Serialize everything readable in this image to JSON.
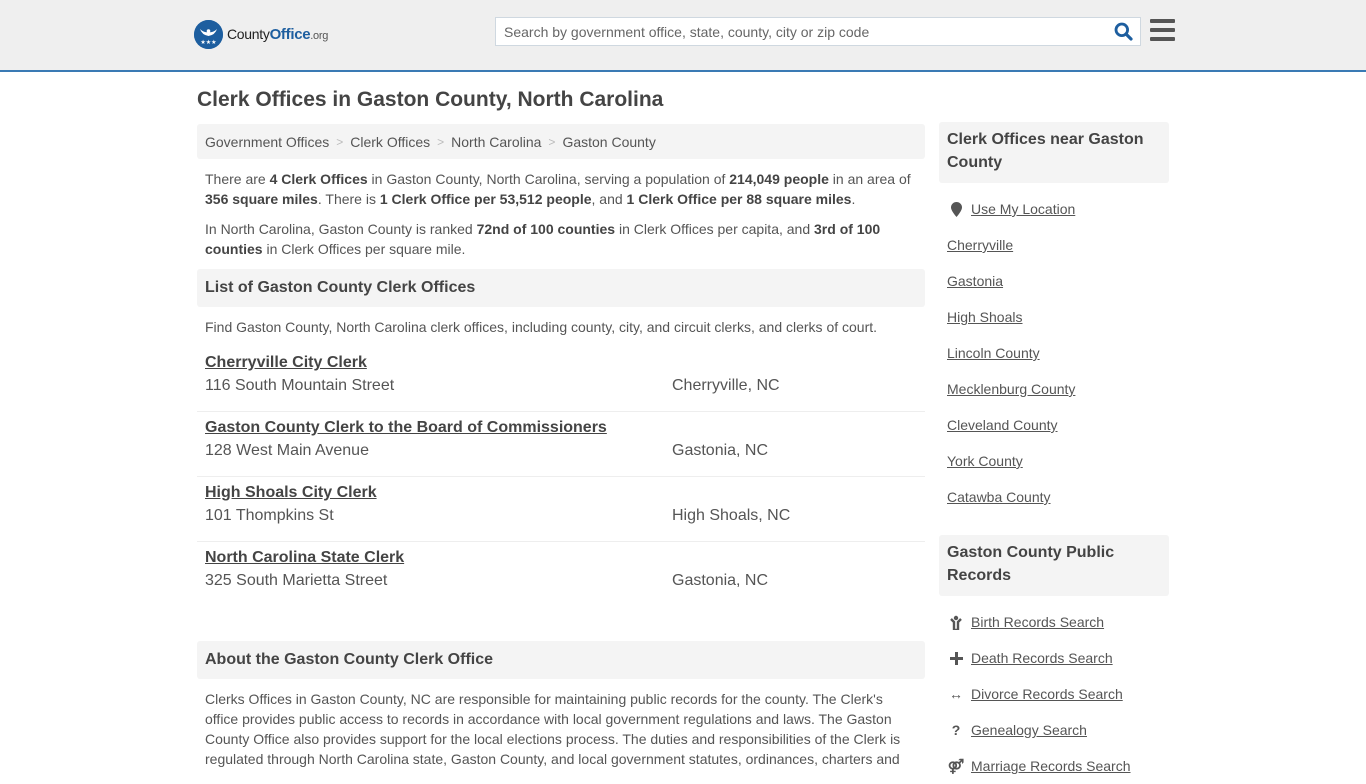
{
  "header": {
    "logo": {
      "brand_prefix": "County",
      "brand_main": "Office",
      "brand_suffix": ".org",
      "badge_stars": "★★★"
    },
    "search": {
      "placeholder": "Search by government office, state, county, city or zip code",
      "value": ""
    },
    "colors": {
      "accent": "#3a7ab4",
      "brand": "#1d5e9f"
    }
  },
  "page_title": "Clerk Offices in Gaston County, North Carolina",
  "breadcrumb": [
    "Government Offices",
    "Clerk Offices",
    "North Carolina",
    "Gaston County"
  ],
  "intro": {
    "p1": [
      {
        "t": "There are ",
        "b": false
      },
      {
        "t": "4 Clerk Offices",
        "b": true
      },
      {
        "t": " in Gaston County, North Carolina, serving a population of ",
        "b": false
      },
      {
        "t": "214,049 people",
        "b": true
      },
      {
        "t": " in an area of ",
        "b": false
      },
      {
        "t": "356 square miles",
        "b": true
      },
      {
        "t": ". There is ",
        "b": false
      },
      {
        "t": "1 Clerk Office per 53,512 people",
        "b": true
      },
      {
        "t": ", and ",
        "b": false
      },
      {
        "t": "1 Clerk Office per 88 square miles",
        "b": true
      },
      {
        "t": ".",
        "b": false
      }
    ],
    "p2": [
      {
        "t": "In North Carolina, Gaston County is ranked ",
        "b": false
      },
      {
        "t": "72nd of 100 counties",
        "b": true
      },
      {
        "t": " in Clerk Offices per capita, and ",
        "b": false
      },
      {
        "t": "3rd of 100 counties",
        "b": true
      },
      {
        "t": " in Clerk Offices per square mile.",
        "b": false
      }
    ]
  },
  "list": {
    "heading": "List of Gaston County Clerk Offices",
    "description": "Find Gaston County, North Carolina clerk offices, including county, city, and circuit clerks, and clerks of court.",
    "offices": [
      {
        "name": "Cherryville City Clerk",
        "address": "116 South Mountain Street",
        "city": "Cherryville, NC"
      },
      {
        "name": "Gaston County Clerk to the Board of Commissioners",
        "address": "128 West Main Avenue",
        "city": "Gastonia, NC"
      },
      {
        "name": "High Shoals City Clerk",
        "address": "101 Thompkins St",
        "city": "High Shoals, NC"
      },
      {
        "name": "North Carolina State Clerk",
        "address": "325 South Marietta Street",
        "city": "Gastonia, NC"
      }
    ]
  },
  "about": {
    "heading": "About the Gaston County Clerk Office",
    "text": "Clerks Offices in Gaston County, NC are responsible for maintaining public records for the county. The Clerk's office provides public access to records in accordance with local government regulations and laws. The Gaston County Office also provides support for the local elections process. The duties and responsibilities of the Clerk is regulated through North Carolina state, Gaston County, and local government statutes, ordinances, charters and"
  },
  "sidebar": {
    "nearby": {
      "heading": "Clerk Offices near Gaston County",
      "use_location": "Use My Location",
      "links": [
        "Cherryville",
        "Gastonia",
        "High Shoals",
        "Lincoln County",
        "Mecklenburg County",
        "Cleveland County",
        "York County",
        "Catawba County"
      ]
    },
    "records": {
      "heading": "Gaston County Public Records",
      "links": [
        {
          "icon": "baby-icon",
          "glyph": "🚼",
          "label": "Birth Records Search"
        },
        {
          "icon": "cross-icon",
          "glyph": "✚",
          "label": "Death Records Search"
        },
        {
          "icon": "arrows-horizontal-icon",
          "glyph": "↔",
          "label": "Divorce Records Search"
        },
        {
          "icon": "question-icon",
          "glyph": "?",
          "label": "Genealogy Search"
        },
        {
          "icon": "marriage-icon",
          "glyph": "⚤",
          "label": "Marriage Records Search"
        }
      ]
    }
  }
}
